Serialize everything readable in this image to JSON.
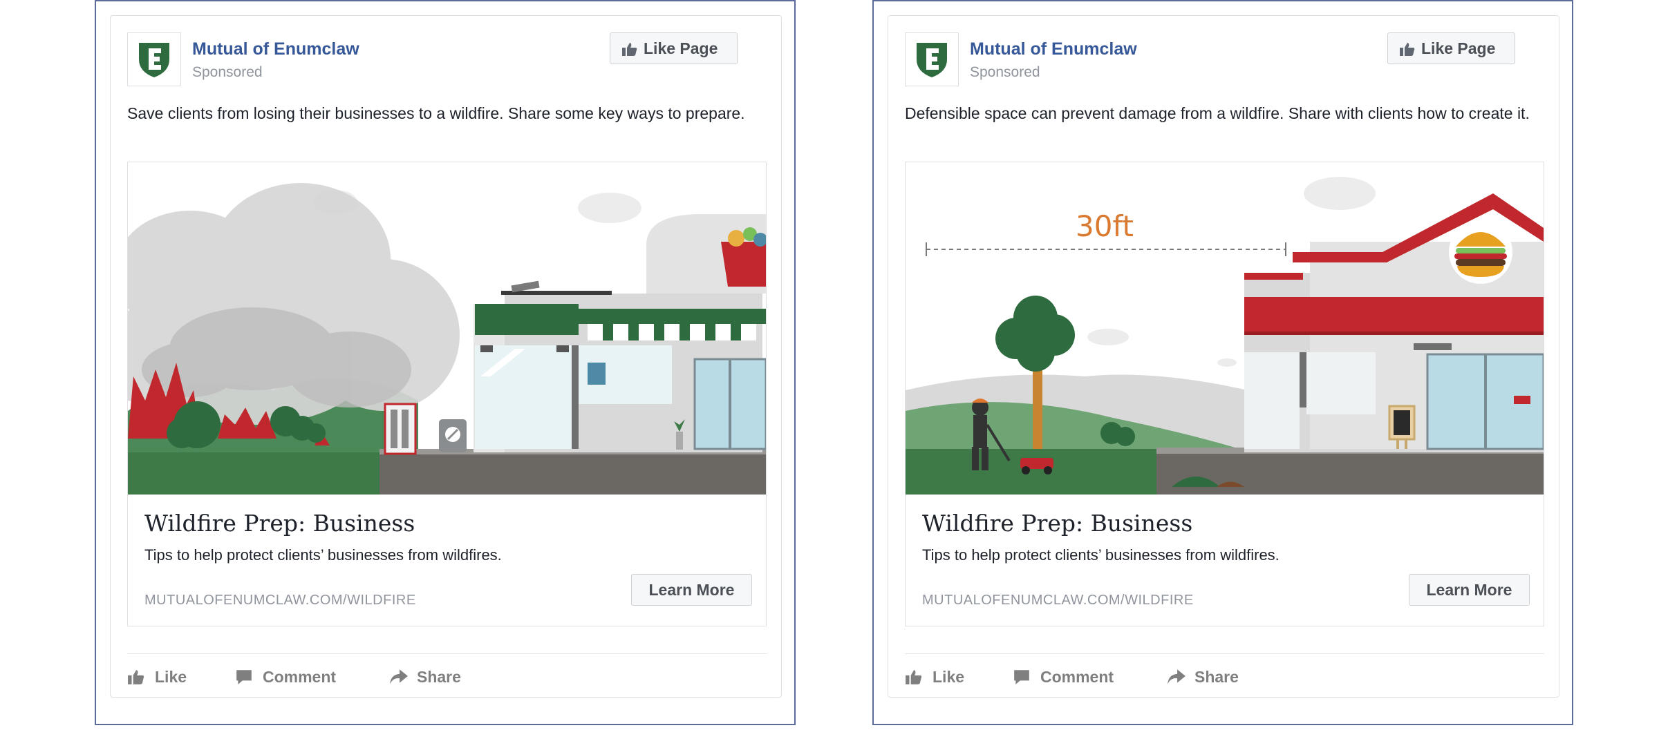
{
  "colors": {
    "page_name": "#365899",
    "brand_green": "#2e6b3e",
    "muted": "#90949c",
    "frame_border": "#5b6b9a"
  },
  "ads": [
    {
      "page_name": "Mutual of Enumclaw",
      "sponsored_label": "Sponsored",
      "like_page_label": "Like Page",
      "post_text": "Save clients from losing their businesses to a wildfire. Share some key ways to prepare.",
      "image_icon": "wildfire-smoke-grocery-store-illustration",
      "headline": "Wildfire Prep: Business",
      "description": "Tips to help protect clients’ businesses from wildfires.",
      "domain": "MUTUALOFENUMCLAW.COM/WILDFIRE",
      "cta_label": "Learn More",
      "actions": {
        "like": "Like",
        "comment": "Comment",
        "share": "Share"
      }
    },
    {
      "page_name": "Mutual of Enumclaw",
      "sponsored_label": "Sponsored",
      "like_page_label": "Like Page",
      "post_text": "Defensible space can prevent damage from a wildfire. Share with clients how to create it.",
      "image_icon": "defensible-space-burger-restaurant-illustration",
      "image_distance_label": "30ft",
      "headline": "Wildfire Prep: Business",
      "description": "Tips to help protect clients’ businesses from wildfires.",
      "domain": "MUTUALOFENUMCLAW.COM/WILDFIRE",
      "cta_label": "Learn More",
      "actions": {
        "like": "Like",
        "comment": "Comment",
        "share": "Share"
      }
    }
  ]
}
